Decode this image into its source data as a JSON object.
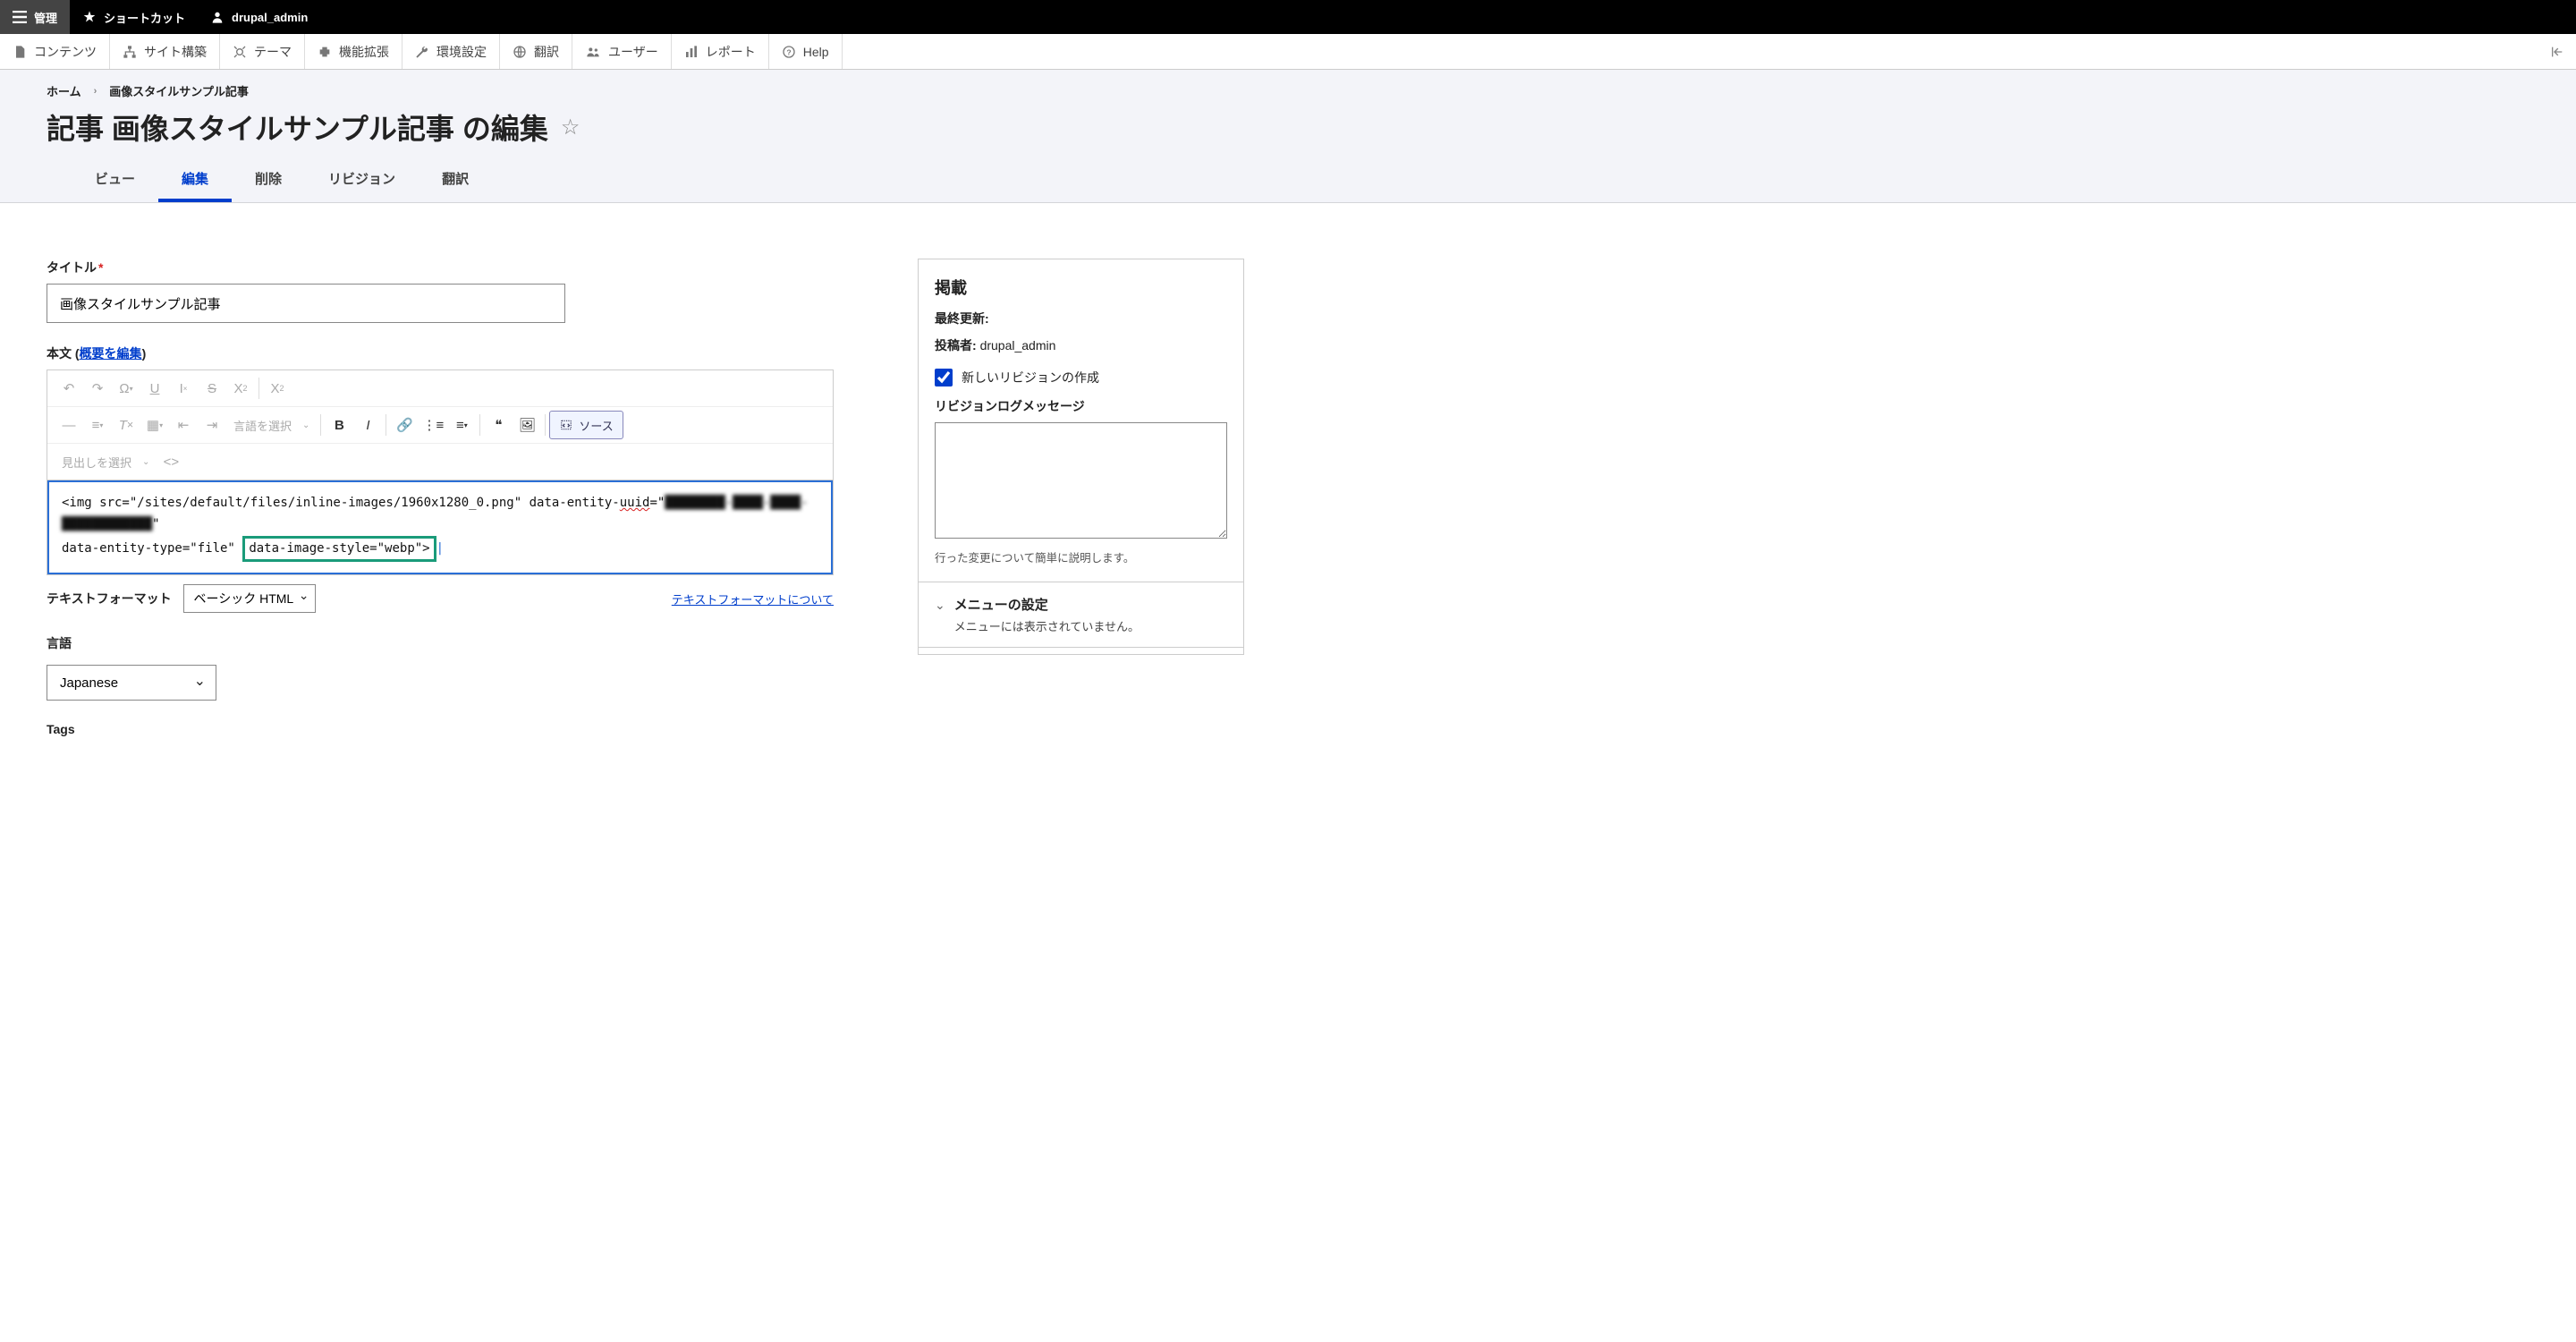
{
  "topbar": {
    "admin_label": "管理",
    "shortcut_label": "ショートカット",
    "user_label": "drupal_admin"
  },
  "admin_menu": {
    "content": "コンテンツ",
    "structure": "サイト構築",
    "appearance": "テーマ",
    "extend": "機能拡張",
    "config": "環境設定",
    "translate": "翻訳",
    "people": "ユーザー",
    "reports": "レポート",
    "help": "Help"
  },
  "breadcrumb": {
    "home": "ホーム",
    "current": "画像スタイルサンプル記事"
  },
  "page_title": "記事 画像スタイルサンプル記事 の編集",
  "tabs": {
    "view": "ビュー",
    "edit": "編集",
    "delete": "削除",
    "revisions": "リビジョン",
    "translate": "翻訳"
  },
  "form": {
    "title_label": "タイトル",
    "title_value": "画像スタイルサンプル記事",
    "body_label": "本文",
    "body_summary_link": "概要を編集",
    "editor": {
      "lang_placeholder": "言語を選択",
      "heading_placeholder": "見出しを選択",
      "source_label": "ソース",
      "source_line1_a": "<img src=\"/sites/default/files/inline-images/1960x1280_0.png\" data-entity-",
      "source_line1_uuid_attr": "uuid",
      "source_line1_b": "=\"",
      "source_line1_uuid_val": "████████-████-████-████████████",
      "source_line1_c": "\"",
      "source_line2_a": "data-entity-type=\"file\"",
      "source_line2_hl": "data-image-style=\"webp\">",
      "cursor": "|"
    },
    "format_label": "テキストフォーマット",
    "format_value": "ベーシック HTML",
    "format_link": "テキストフォーマットについて",
    "lang_label": "言語",
    "lang_value": "Japanese",
    "tags_label": "Tags"
  },
  "sidebar": {
    "pub_title": "掲載",
    "last_updated_label": "最終更新:",
    "author_label": "投稿者:",
    "author_value": "drupal_admin",
    "revision_chk": "新しいリビジョンの作成",
    "revision_log_label": "リビジョンログメッセージ",
    "revision_help": "行った変更について簡単に説明します。",
    "menu_title": "メニューの設定",
    "menu_sub": "メニューには表示されていません。"
  }
}
